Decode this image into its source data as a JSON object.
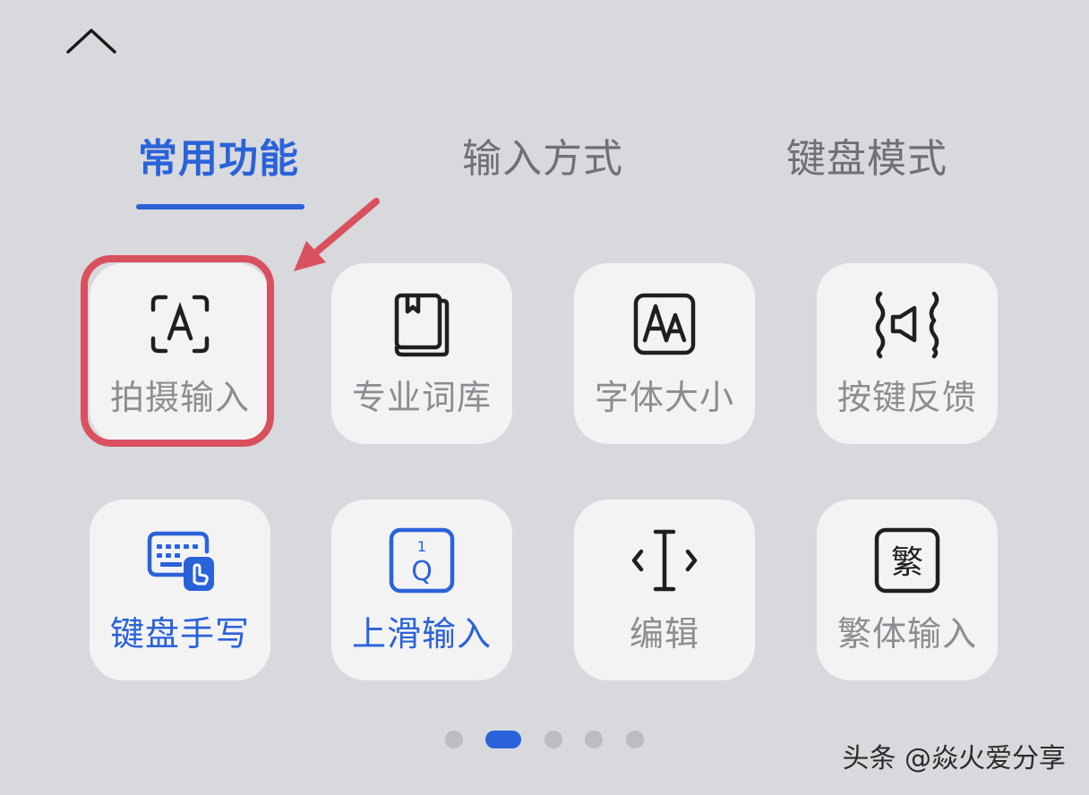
{
  "tabs": {
    "common": "常用功能",
    "input_method": "输入方式",
    "keyboard_mode": "键盘模式"
  },
  "tiles": {
    "photo_input": {
      "label": "拍摄输入",
      "icon": "text-scan-icon"
    },
    "pro_dictionary": {
      "label": "专业词库",
      "icon": "book-icon"
    },
    "font_size": {
      "label": "字体大小",
      "icon": "font-size-icon"
    },
    "key_feedback": {
      "label": "按键反馈",
      "icon": "vibration-sound-icon"
    },
    "keyboard_handwriting": {
      "label": "键盘手写",
      "icon": "keyboard-handwriting-icon"
    },
    "swipe_up_input": {
      "label": "上滑输入",
      "icon": "swipe-key-icon",
      "key_number": "1",
      "key_letter": "Q"
    },
    "edit": {
      "label": "编辑",
      "icon": "text-cursor-icon"
    },
    "traditional_input": {
      "label": "繁体输入",
      "icon": "traditional-char-icon",
      "glyph": "繁"
    }
  },
  "pagination": {
    "pages": 5,
    "current": 2
  },
  "watermark": "头条 @焱火爱分享",
  "colors": {
    "accent": "#2a62d9",
    "highlight": "#d9505e",
    "background": "#d8d9dc",
    "tile": "#f3f3f4"
  }
}
